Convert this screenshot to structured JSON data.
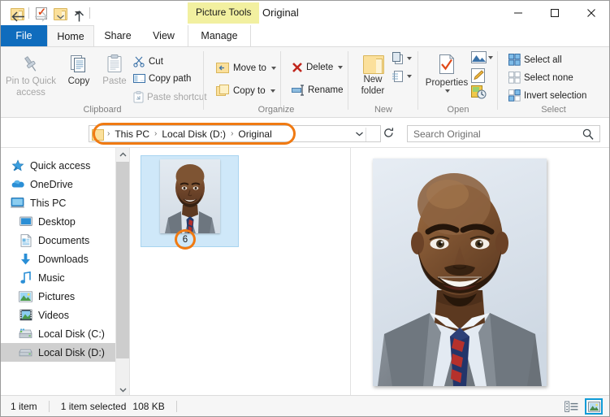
{
  "window": {
    "title": "Original",
    "contextual_tab": "Picture Tools",
    "controls": {
      "minimize": "minimize-icon",
      "maximize": "maximize-icon",
      "close": "close-icon",
      "collapse_ribbon": "chevron-up-icon",
      "help": "help-icon"
    }
  },
  "quick_access": {
    "items": [
      {
        "name": "folder-icon",
        "label": "Folder properties"
      },
      {
        "name": "properties-icon",
        "label": "Properties"
      },
      {
        "name": "new-folder-icon",
        "label": "New folder"
      },
      {
        "name": "chevron-down-icon",
        "label": "Customize Quick Access Toolbar"
      }
    ]
  },
  "tabs": [
    {
      "id": "file",
      "label": "File"
    },
    {
      "id": "home",
      "label": "Home"
    },
    {
      "id": "share",
      "label": "Share"
    },
    {
      "id": "view",
      "label": "View"
    },
    {
      "id": "manage",
      "label": "Manage"
    }
  ],
  "active_tab": "Home",
  "ribbon": {
    "groups": [
      {
        "id": "clipboard",
        "label": "Clipboard",
        "large_buttons": [
          {
            "id": "pin",
            "label_line1": "Pin to Quick",
            "label_line2": "access",
            "icon": "pin-icon",
            "enabled": false
          },
          {
            "id": "copy",
            "label_line1": "Copy",
            "label_line2": "",
            "icon": "copy-icon",
            "enabled": true
          },
          {
            "id": "paste",
            "label_line1": "Paste",
            "label_line2": "",
            "icon": "paste-icon",
            "enabled": false
          }
        ],
        "small_buttons": [
          {
            "id": "cut",
            "label": "Cut",
            "icon": "scissors-icon",
            "enabled": true
          },
          {
            "id": "copy-path",
            "label": "Copy path",
            "icon": "copy-path-icon",
            "enabled": true
          },
          {
            "id": "paste-shortcut",
            "label": "Paste shortcut",
            "icon": "paste-shortcut-icon",
            "enabled": false
          }
        ]
      },
      {
        "id": "organize",
        "label": "Organize",
        "small_buttons": [
          {
            "id": "move-to",
            "label": "Move to",
            "icon": "move-to-icon",
            "has_caret": true
          },
          {
            "id": "copy-to",
            "label": "Copy to",
            "icon": "copy-to-icon",
            "has_caret": true
          },
          {
            "id": "delete",
            "label": "Delete",
            "icon": "delete-icon",
            "has_caret": true
          },
          {
            "id": "rename",
            "label": "Rename",
            "icon": "rename-icon",
            "has_caret": false
          }
        ]
      },
      {
        "id": "new",
        "label": "New",
        "large_buttons": [
          {
            "id": "new-folder",
            "label_line1": "New",
            "label_line2": "folder",
            "icon": "new-folder-icon",
            "enabled": true
          }
        ],
        "split_icons": [
          {
            "id": "new-item",
            "icon": "new-item-icon",
            "has_caret": true
          },
          {
            "id": "easy-access",
            "icon": "easy-access-icon",
            "has_caret": true
          }
        ]
      },
      {
        "id": "open",
        "label": "Open",
        "large_buttons": [
          {
            "id": "properties",
            "label_line1": "Properties",
            "label_line2": "",
            "icon": "properties-icon",
            "enabled": true,
            "has_caret": true
          }
        ],
        "split_icons": [
          {
            "id": "open-with",
            "icon": "open-picture-icon",
            "has_caret": true
          },
          {
            "id": "edit",
            "icon": "edit-pencil-icon",
            "has_caret": false
          },
          {
            "id": "history",
            "icon": "history-icon",
            "has_caret": false
          }
        ]
      },
      {
        "id": "select",
        "label": "Select",
        "small_buttons": [
          {
            "id": "select-all",
            "label": "Select all",
            "icon": "select-all-icon"
          },
          {
            "id": "select-none",
            "label": "Select none",
            "icon": "select-none-icon"
          },
          {
            "id": "invert-selection",
            "label": "Invert selection",
            "icon": "invert-selection-icon"
          }
        ]
      }
    ]
  },
  "navigation": {
    "back": "back-arrow-icon",
    "forward": "forward-arrow-icon",
    "recent": "chevron-down-icon",
    "up": "up-arrow-icon",
    "refresh": "refresh-icon",
    "address_dropdown": "chevron-down-icon"
  },
  "breadcrumb": {
    "items": [
      "This PC",
      "Local Disk (D:)",
      "Original"
    ],
    "separator": "›"
  },
  "search": {
    "placeholder": "Search Original",
    "icon": "search-icon"
  },
  "sidebar": {
    "items": [
      {
        "label": "Quick access",
        "icon": "star-icon",
        "indent": false,
        "selected": false
      },
      {
        "label": "OneDrive",
        "icon": "cloud-icon",
        "indent": false,
        "selected": false
      },
      {
        "label": "This PC",
        "icon": "computer-icon",
        "indent": false,
        "selected": false
      },
      {
        "label": "Desktop",
        "icon": "desktop-icon",
        "indent": true,
        "selected": false
      },
      {
        "label": "Documents",
        "icon": "documents-icon",
        "indent": true,
        "selected": false
      },
      {
        "label": "Downloads",
        "icon": "downloads-icon",
        "indent": true,
        "selected": false
      },
      {
        "label": "Music",
        "icon": "music-icon",
        "indent": true,
        "selected": false
      },
      {
        "label": "Pictures",
        "icon": "pictures-icon",
        "indent": true,
        "selected": false
      },
      {
        "label": "Videos",
        "icon": "videos-icon",
        "indent": true,
        "selected": false
      },
      {
        "label": "Local Disk (C:)",
        "icon": "hard-drive-icon",
        "indent": true,
        "selected": false
      },
      {
        "label": "Local Disk (D:)",
        "icon": "hard-drive-icon",
        "indent": true,
        "selected": true
      }
    ]
  },
  "files": [
    {
      "name": "",
      "selected": true,
      "thumbnail": "portrait-photo-thumbnail"
    }
  ],
  "annotations": {
    "address_highlight": {
      "shape": "rounded-rectangle",
      "color": "#f07a12"
    },
    "badge": {
      "number": "6",
      "color": "#f07a12",
      "shape": "circle"
    }
  },
  "preview": {
    "image_alt": "portrait-photo-preview"
  },
  "statusbar": {
    "item_count": "1 item",
    "selection": "1 item selected",
    "size": "108 KB",
    "views": [
      {
        "id": "details-view",
        "icon": "details-view-icon",
        "active": false
      },
      {
        "id": "large-icons-view",
        "icon": "large-icons-view-icon",
        "active": true
      }
    ]
  },
  "colors": {
    "accent_blue": "#0f6cbd",
    "annotation_orange": "#f07a12",
    "contextual_yellow": "#f2f0a0",
    "selection_blue": "#cfe8f9"
  }
}
